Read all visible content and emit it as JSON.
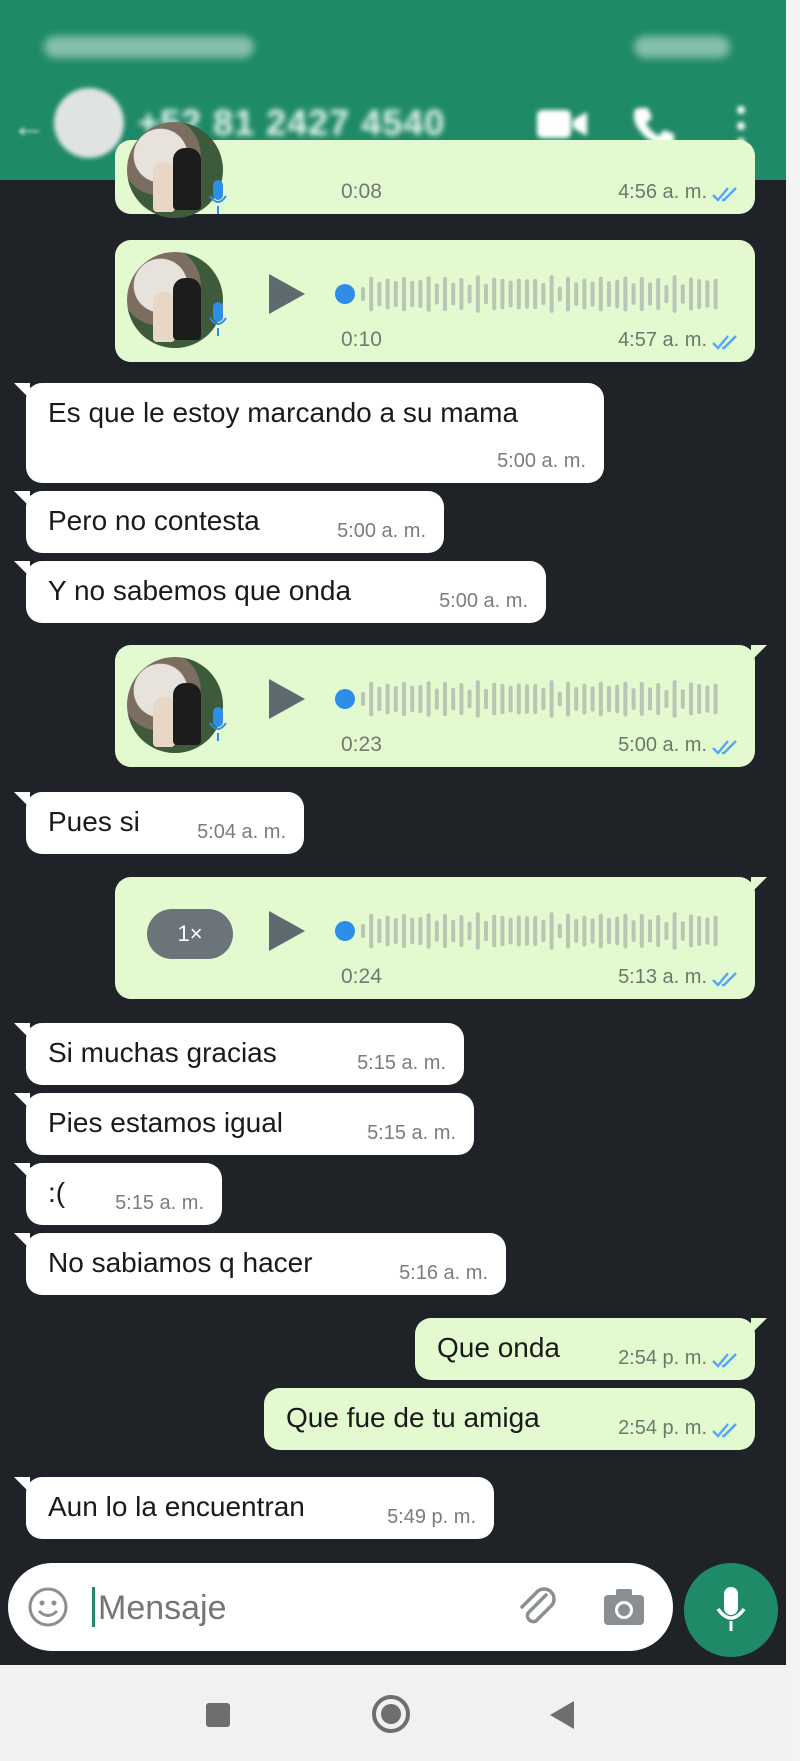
{
  "status_bar": {
    "left": "",
    "right": ""
  },
  "header": {
    "contact_name": "+52 81 2427 4540"
  },
  "messages": [
    {
      "dir": "out",
      "kind": "voice",
      "duration": "0:08",
      "time": "4:56 a. m."
    },
    {
      "dir": "out",
      "kind": "voice",
      "duration": "0:10",
      "time": "4:57 a. m."
    },
    {
      "dir": "in",
      "text": "Es que le estoy marcando a su mama",
      "time": "5:00 a. m."
    },
    {
      "dir": "in",
      "text": "Pero no contesta",
      "time": "5:00 a. m."
    },
    {
      "dir": "in",
      "text": "Y no sabemos que onda",
      "time": "5:00 a. m."
    },
    {
      "dir": "out",
      "kind": "voice",
      "duration": "0:23",
      "time": "5:00 a. m."
    },
    {
      "dir": "in",
      "text": "Pues si",
      "time": "5:04 a. m."
    },
    {
      "dir": "out",
      "kind": "voice",
      "duration": "0:24",
      "time": "5:13 a. m.",
      "speed": "1×"
    },
    {
      "dir": "in",
      "text": "Si muchas gracias",
      "time": "5:15 a. m."
    },
    {
      "dir": "in",
      "text": "Pies estamos igual",
      "time": "5:15 a. m."
    },
    {
      "dir": "in",
      "text": ":(",
      "time": "5:15 a. m."
    },
    {
      "dir": "in",
      "text": "No sabiamos q hacer",
      "time": "5:16 a. m."
    },
    {
      "dir": "out",
      "text": "Que onda",
      "time": "2:54 p. m."
    },
    {
      "dir": "out",
      "text": "Que fue de tu amiga",
      "time": "2:54 p. m."
    },
    {
      "dir": "in",
      "text": "Aun lo la encuentran",
      "time": "5:49 p. m."
    }
  ],
  "composer": {
    "placeholder": "Mensaje"
  },
  "colors": {
    "header": "#1f8a68",
    "chat_bg": "#1f2327",
    "outgoing": "#e3fad1",
    "incoming": "#ffffff",
    "tick_blue": "#53a6f5",
    "voice_dot": "#2e8de6"
  },
  "icons": [
    "back-arrow-icon",
    "video-call-icon",
    "phone-icon",
    "more-vert-icon",
    "play-icon",
    "microphone-icon",
    "double-check-icon",
    "emoji-icon",
    "attach-icon",
    "camera-icon",
    "nav-recents-icon",
    "nav-home-icon",
    "nav-back-icon"
  ]
}
